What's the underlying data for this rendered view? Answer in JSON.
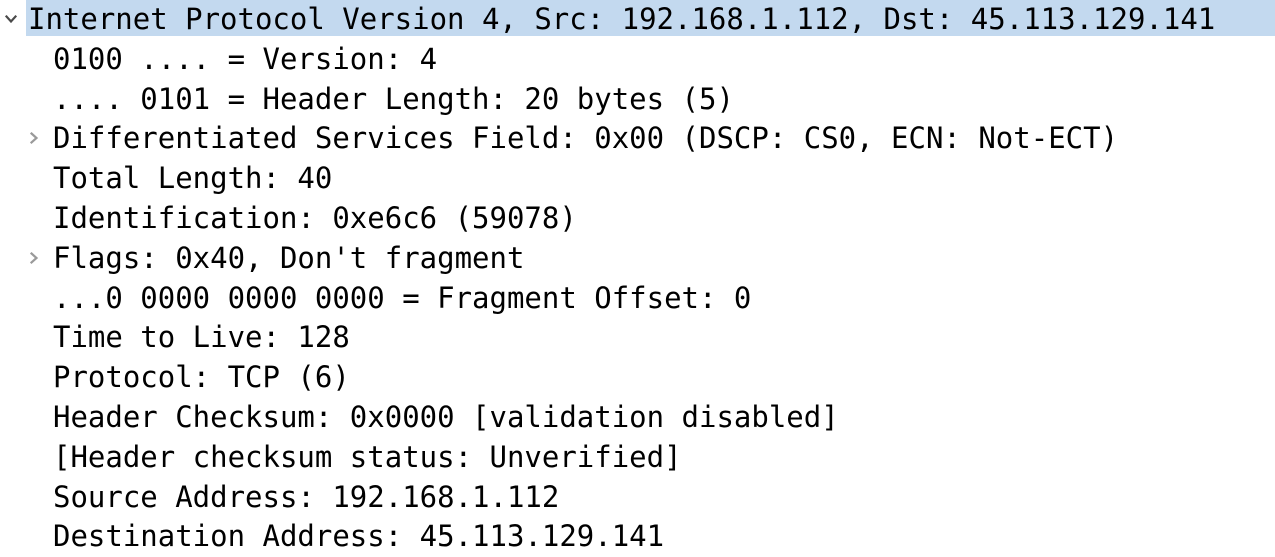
{
  "panel": {
    "name": "packet-details-tree",
    "colors": {
      "selection_background": "#c3d9ef",
      "text": "#000000",
      "twisty_collapsed": "#9a9a9a",
      "twisty_expanded": "#4a4a4a",
      "background": "#ffffff"
    }
  },
  "rows": [
    {
      "text": "Internet Protocol Version 4, Src: 192.168.1.112, Dst: 45.113.129.141",
      "level": 0,
      "twisty": "expanded",
      "selected": true,
      "name": "tree-row-internet-protocol-version-4"
    },
    {
      "text": "0100 .... = Version: 4",
      "level": 1,
      "twisty": "none",
      "selected": false,
      "name": "tree-row-version"
    },
    {
      "text": ".... 0101 = Header Length: 20 bytes (5)",
      "level": 1,
      "twisty": "none",
      "selected": false,
      "name": "tree-row-header-length"
    },
    {
      "text": "Differentiated Services Field: 0x00 (DSCP: CS0, ECN: Not-ECT)",
      "level": 1,
      "twisty": "collapsed",
      "selected": false,
      "name": "tree-row-differentiated-services-field"
    },
    {
      "text": "Total Length: 40",
      "level": 1,
      "twisty": "none",
      "selected": false,
      "name": "tree-row-total-length"
    },
    {
      "text": "Identification: 0xe6c6 (59078)",
      "level": 1,
      "twisty": "none",
      "selected": false,
      "name": "tree-row-identification"
    },
    {
      "text": "Flags: 0x40, Don't fragment",
      "level": 1,
      "twisty": "collapsed",
      "selected": false,
      "name": "tree-row-flags"
    },
    {
      "text": "...0 0000 0000 0000 = Fragment Offset: 0",
      "level": 1,
      "twisty": "none",
      "selected": false,
      "name": "tree-row-fragment-offset"
    },
    {
      "text": "Time to Live: 128",
      "level": 1,
      "twisty": "none",
      "selected": false,
      "name": "tree-row-time-to-live"
    },
    {
      "text": "Protocol: TCP (6)",
      "level": 1,
      "twisty": "none",
      "selected": false,
      "name": "tree-row-protocol"
    },
    {
      "text": "Header Checksum: 0x0000 [validation disabled]",
      "level": 1,
      "twisty": "none",
      "selected": false,
      "name": "tree-row-header-checksum"
    },
    {
      "text": "[Header checksum status: Unverified]",
      "level": 1,
      "twisty": "none",
      "selected": false,
      "name": "tree-row-header-checksum-status"
    },
    {
      "text": "Source Address: 192.168.1.112",
      "level": 1,
      "twisty": "none",
      "selected": false,
      "name": "tree-row-source-address"
    },
    {
      "text": "Destination Address: 45.113.129.141",
      "level": 1,
      "twisty": "none",
      "selected": false,
      "name": "tree-row-destination-address"
    }
  ]
}
